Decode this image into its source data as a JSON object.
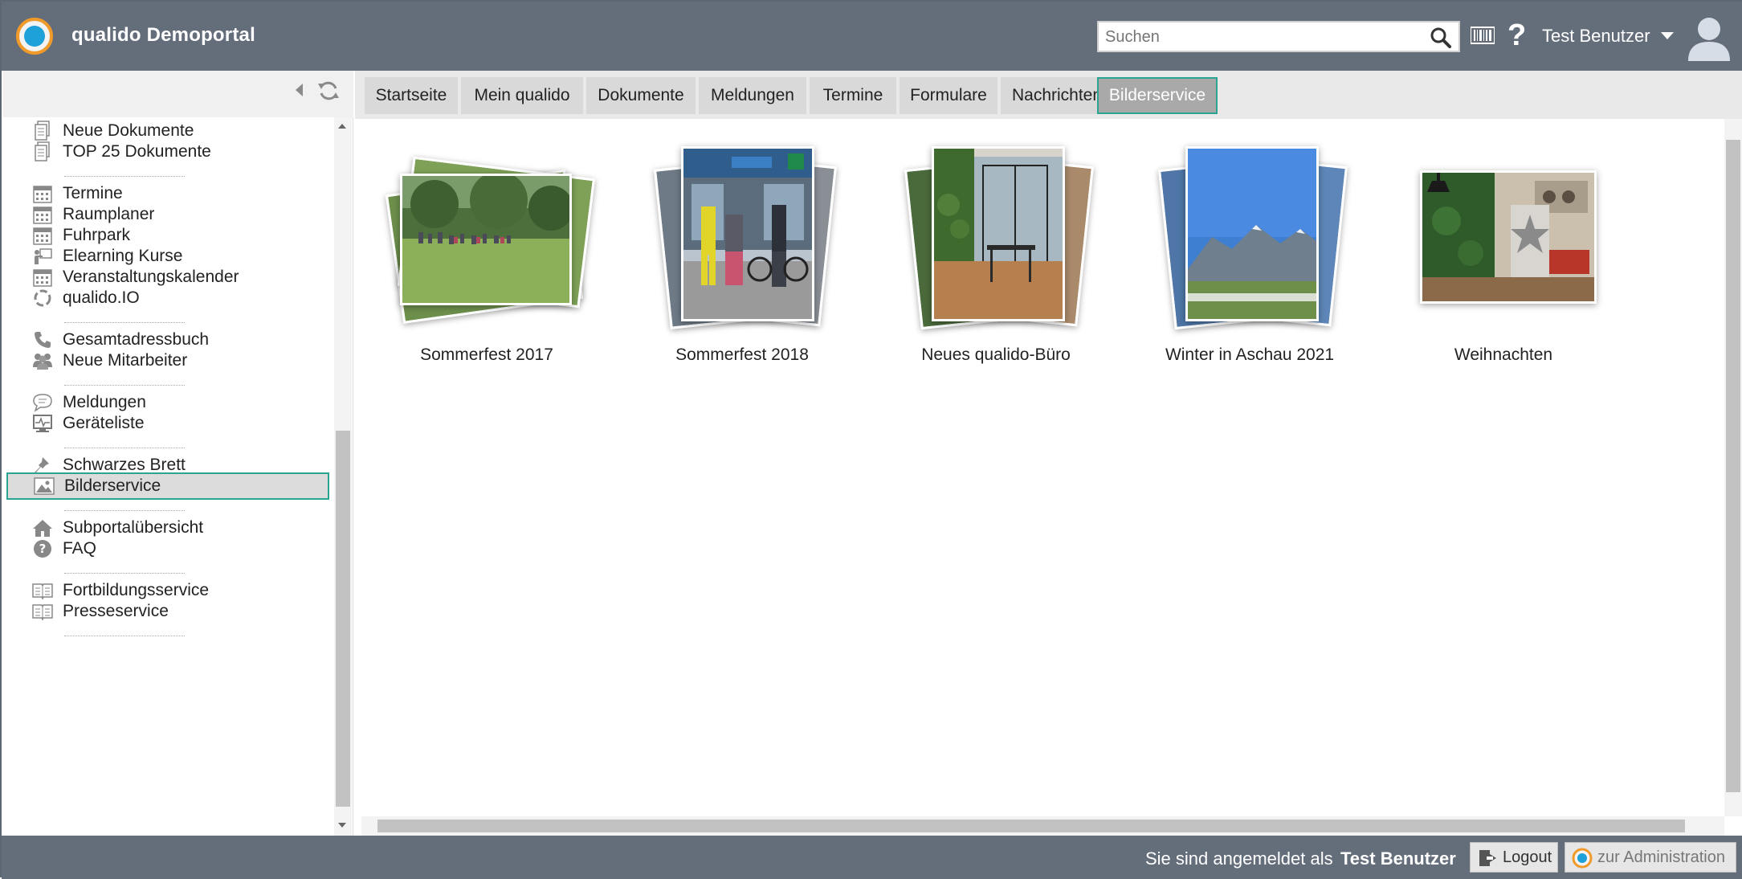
{
  "header": {
    "app_title": "qualido Demoportal",
    "search_placeholder": "Suchen",
    "help_glyph": "?",
    "user_name": "Test Benutzer"
  },
  "sidebar": {
    "items": [
      {
        "label": "Neue Dokumente",
        "icon": "document-icon"
      },
      {
        "label": "TOP 25 Dokumente",
        "icon": "document-icon"
      },
      {
        "label": "Termine",
        "icon": "calendar-icon"
      },
      {
        "label": "Raumplaner",
        "icon": "calendar-icon"
      },
      {
        "label": "Fuhrpark",
        "icon": "calendar-icon"
      },
      {
        "label": "Elearning Kurse",
        "icon": "presentation-icon"
      },
      {
        "label": "Veranstaltungskalender",
        "icon": "calendar-icon"
      },
      {
        "label": "qualido.IO",
        "icon": "loading-circle-icon"
      },
      {
        "label": "Gesamtadressbuch",
        "icon": "phone-icon"
      },
      {
        "label": "Neue Mitarbeiter",
        "icon": "people-icon"
      },
      {
        "label": "Meldungen",
        "icon": "speech-bubble-icon"
      },
      {
        "label": "Geräteliste",
        "icon": "monitor-icon"
      },
      {
        "label": "Schwarzes Brett",
        "icon": "pin-icon"
      },
      {
        "label": "Bilderservice",
        "icon": "image-icon",
        "active": true
      },
      {
        "label": "Subportalübersicht",
        "icon": "home-icon"
      },
      {
        "label": "FAQ",
        "icon": "question-circle-icon"
      },
      {
        "label": "Fortbildungsservice",
        "icon": "book-icon"
      },
      {
        "label": "Presseservice",
        "icon": "book-icon"
      }
    ]
  },
  "tabs": [
    {
      "label": "Startseite"
    },
    {
      "label": "Mein qualido"
    },
    {
      "label": "Dokumente"
    },
    {
      "label": "Meldungen"
    },
    {
      "label": "Termine"
    },
    {
      "label": "Formulare"
    },
    {
      "label": "Nachrichten"
    },
    {
      "label": "Bilderservice",
      "active": true
    }
  ],
  "albums": [
    {
      "label": "Sommerfest 2017"
    },
    {
      "label": "Sommerfest 2018"
    },
    {
      "label": "Neues qualido-Büro"
    },
    {
      "label": "Winter in Aschau 2021"
    },
    {
      "label": "Weihnachten"
    }
  ],
  "footer": {
    "logged_in_text": "Sie sind angemeldet als",
    "user_name": "Test Benutzer",
    "logout_label": "Logout",
    "admin_label": "zur Administration"
  },
  "colors": {
    "header_bg": "#646e7b",
    "accent": "#2aa592",
    "tab_bg": "#d9d9d9",
    "active_tab_bg": "#a9a9a9"
  }
}
